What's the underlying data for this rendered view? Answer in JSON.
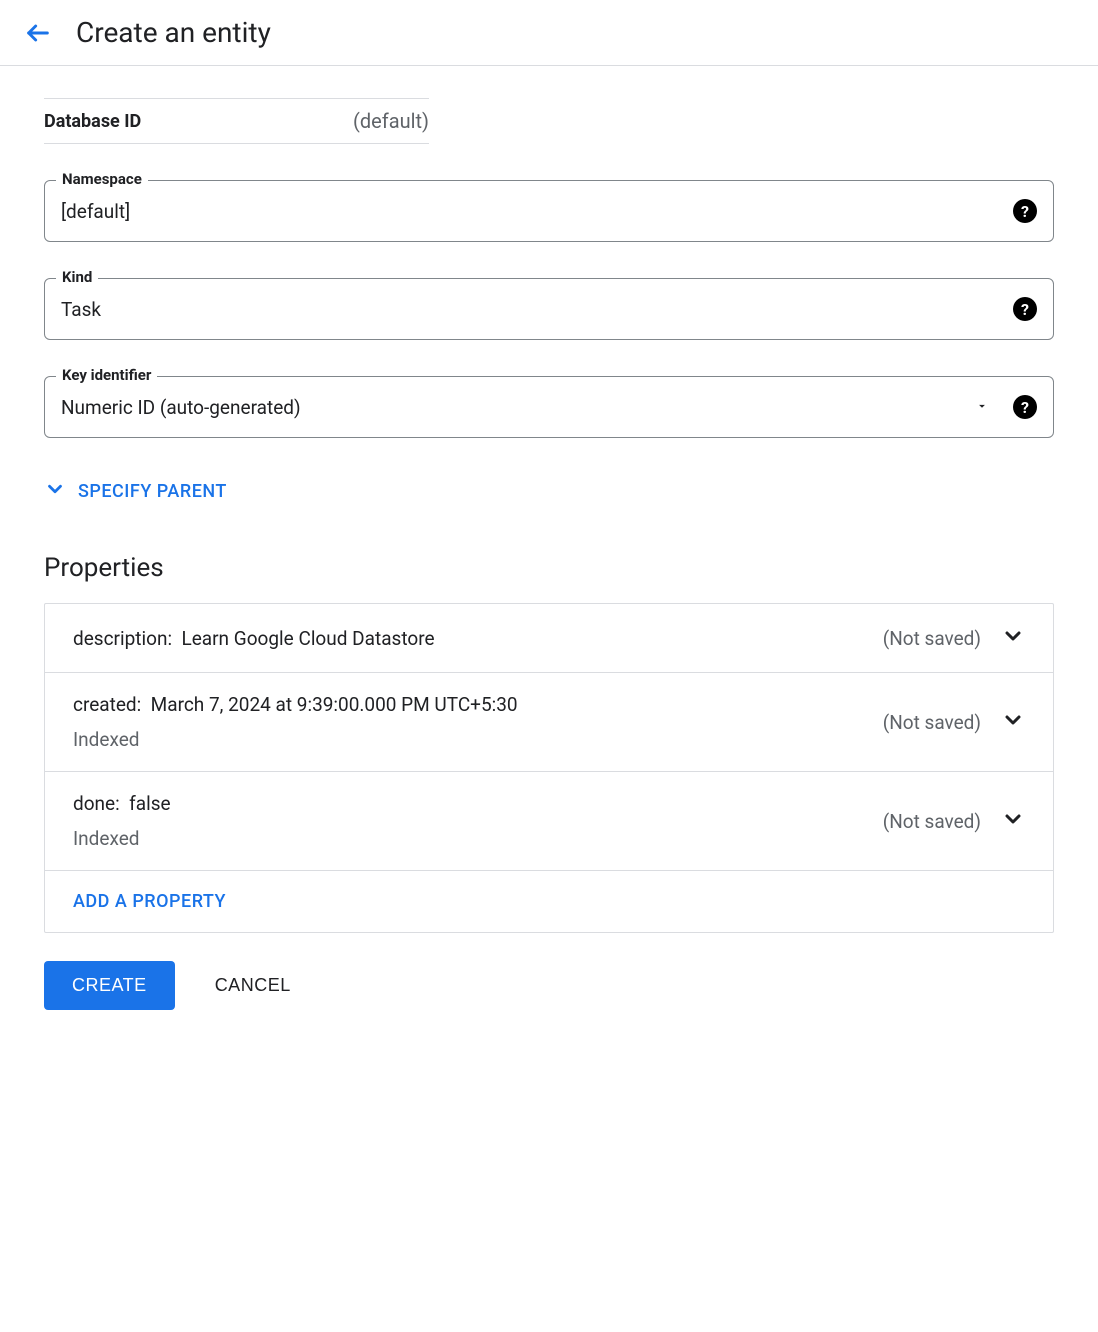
{
  "header": {
    "title": "Create an entity"
  },
  "database": {
    "label": "Database ID",
    "value": "(default)"
  },
  "fields": {
    "namespace": {
      "label": "Namespace",
      "value": "[default]"
    },
    "kind": {
      "label": "Kind",
      "value": "Task"
    },
    "keyIdentifier": {
      "label": "Key identifier",
      "value": "Numeric ID (auto-generated)"
    }
  },
  "specifyParent": "SPECIFY PARENT",
  "propertiesTitle": "Properties",
  "properties": [
    {
      "key": "description",
      "value": "Learn Google Cloud Datastore",
      "indexed": false,
      "status": "(Not saved)"
    },
    {
      "key": "created",
      "value": "March 7, 2024 at 9:39:00.000 PM UTC+5:30",
      "indexed": true,
      "status": "(Not saved)"
    },
    {
      "key": "done",
      "value": "false",
      "indexed": true,
      "status": "(Not saved)"
    }
  ],
  "indexedLabel": "Indexed",
  "addProperty": "ADD A PROPERTY",
  "buttons": {
    "create": "CREATE",
    "cancel": "CANCEL"
  }
}
